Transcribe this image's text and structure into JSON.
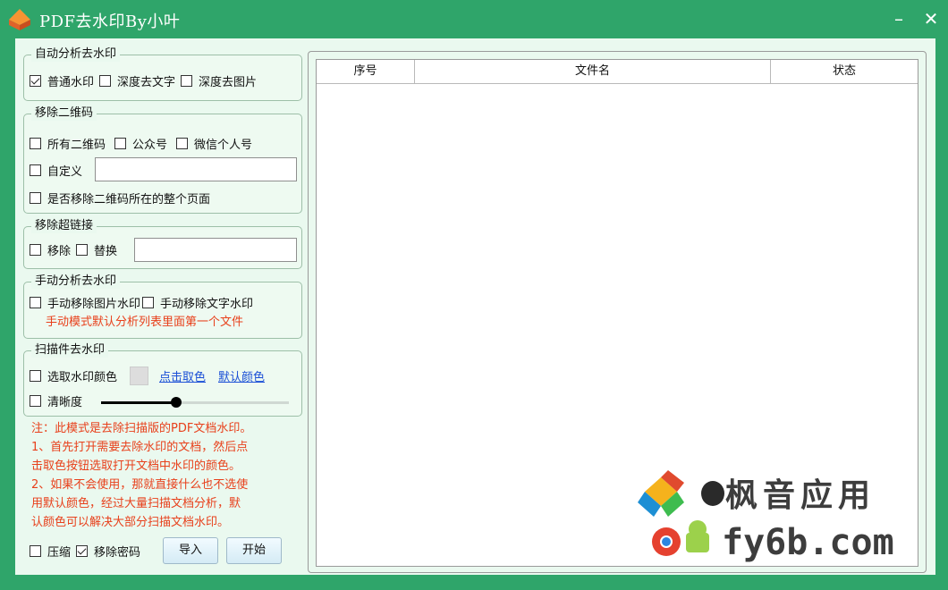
{
  "window": {
    "title": "PDF去水印By小叶",
    "minimize": "–",
    "close": "✕"
  },
  "auto_section": {
    "legend": "自动分析去水印",
    "options": [
      {
        "label": "普通水印",
        "checked": true
      },
      {
        "label": "深度去文字",
        "checked": false
      },
      {
        "label": "深度去图片",
        "checked": false
      }
    ]
  },
  "qr_section": {
    "legend": "移除二维码",
    "options": [
      {
        "label": "所有二维码",
        "checked": false
      },
      {
        "label": "公众号",
        "checked": false
      },
      {
        "label": "微信个人号",
        "checked": false
      }
    ],
    "custom_label": "自定义",
    "custom_value": "",
    "whole_page_label": "是否移除二维码所在的整个页面"
  },
  "link_section": {
    "legend": "移除超链接",
    "remove_label": "移除",
    "replace_label": "替换",
    "replace_value": ""
  },
  "manual_section": {
    "legend": "手动分析去水印",
    "image_label": "手动移除图片水印",
    "text_label": "手动移除文字水印",
    "hint": "手动模式默认分析列表里面第一个文件"
  },
  "scan_section": {
    "legend": "扫描件去水印",
    "pick_color_label": "选取水印颜色",
    "swatch_color": "#dddddd",
    "click_pick_link": "点击取色",
    "default_color_link": "默认颜色",
    "clarity_label": "清晰度",
    "clarity_level": 0.4
  },
  "notes": [
    "注：此模式是去除扫描版的PDF文档水印。",
    "1、首先打开需要去除水印的文档，然后点",
    "击取色按钮选取打开文档中水印的颜色。",
    "2、如果不会使用，那就直接什么也不选使",
    "用默认颜色，经过大量扫描文档分析，默",
    "认颜色可以解决大部分扫描文档水印。"
  ],
  "bottom": {
    "compress_label": "压缩",
    "remove_password_label": "移除密码",
    "remove_password_checked": true,
    "import_button": "导入",
    "start_button": "开始"
  },
  "file_list": {
    "columns": [
      "序号",
      "文件名",
      "状态"
    ],
    "rows": []
  },
  "watermark": {
    "brand_cn": "枫音应用",
    "brand_url": "fy6b.com"
  },
  "colors": {
    "window_green": "#2fa56a",
    "note_red": "#e8401b",
    "link_blue": "#1a4fd6"
  }
}
